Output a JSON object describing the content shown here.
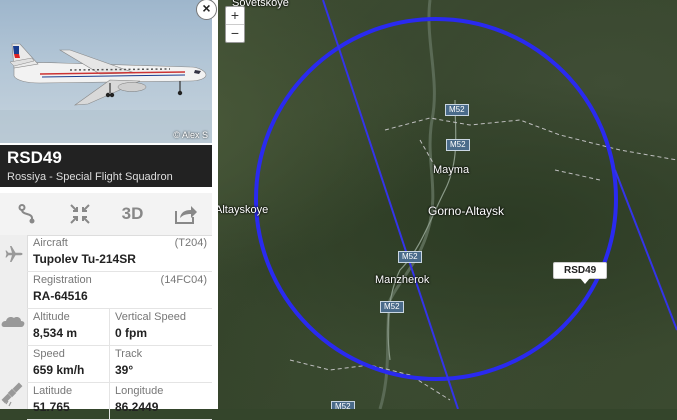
{
  "map": {
    "zoom_in": "+",
    "zoom_out": "−",
    "places": {
      "sovetskoye": "Sovetskoye",
      "mayma": "Mayma",
      "gorno_altaysk": "Gorno-Altaysk",
      "altayskoye": "Altayskoye",
      "manzherok": "Manzherok"
    },
    "road_label": "M52",
    "plane_label": "RSD49",
    "circle_color": "#2a2af0",
    "plane_color": "#d8242e"
  },
  "flight": {
    "photo_credit": "© Alex S",
    "close_label": "×",
    "callsign": "RSD49",
    "airline": "Rossiya - Special Flight Squadron",
    "actions": {
      "threed_label": "3D"
    },
    "aircraft_label": "Aircraft",
    "aircraft_code": "(T204)",
    "aircraft_value": "Tupolev Tu-214SR",
    "registration_label": "Registration",
    "registration_code": "(14FC04)",
    "registration_value": "RA-64516",
    "altitude_label": "Altitude",
    "altitude_value": "8,534 m",
    "vspeed_label": "Vertical Speed",
    "vspeed_value": "0 fpm",
    "speed_label": "Speed",
    "speed_value": "659 km/h",
    "track_label": "Track",
    "track_value": "39°",
    "latitude_label": "Latitude",
    "latitude_value": "51.765",
    "longitude_label": "Longitude",
    "longitude_value": "86.2449"
  }
}
